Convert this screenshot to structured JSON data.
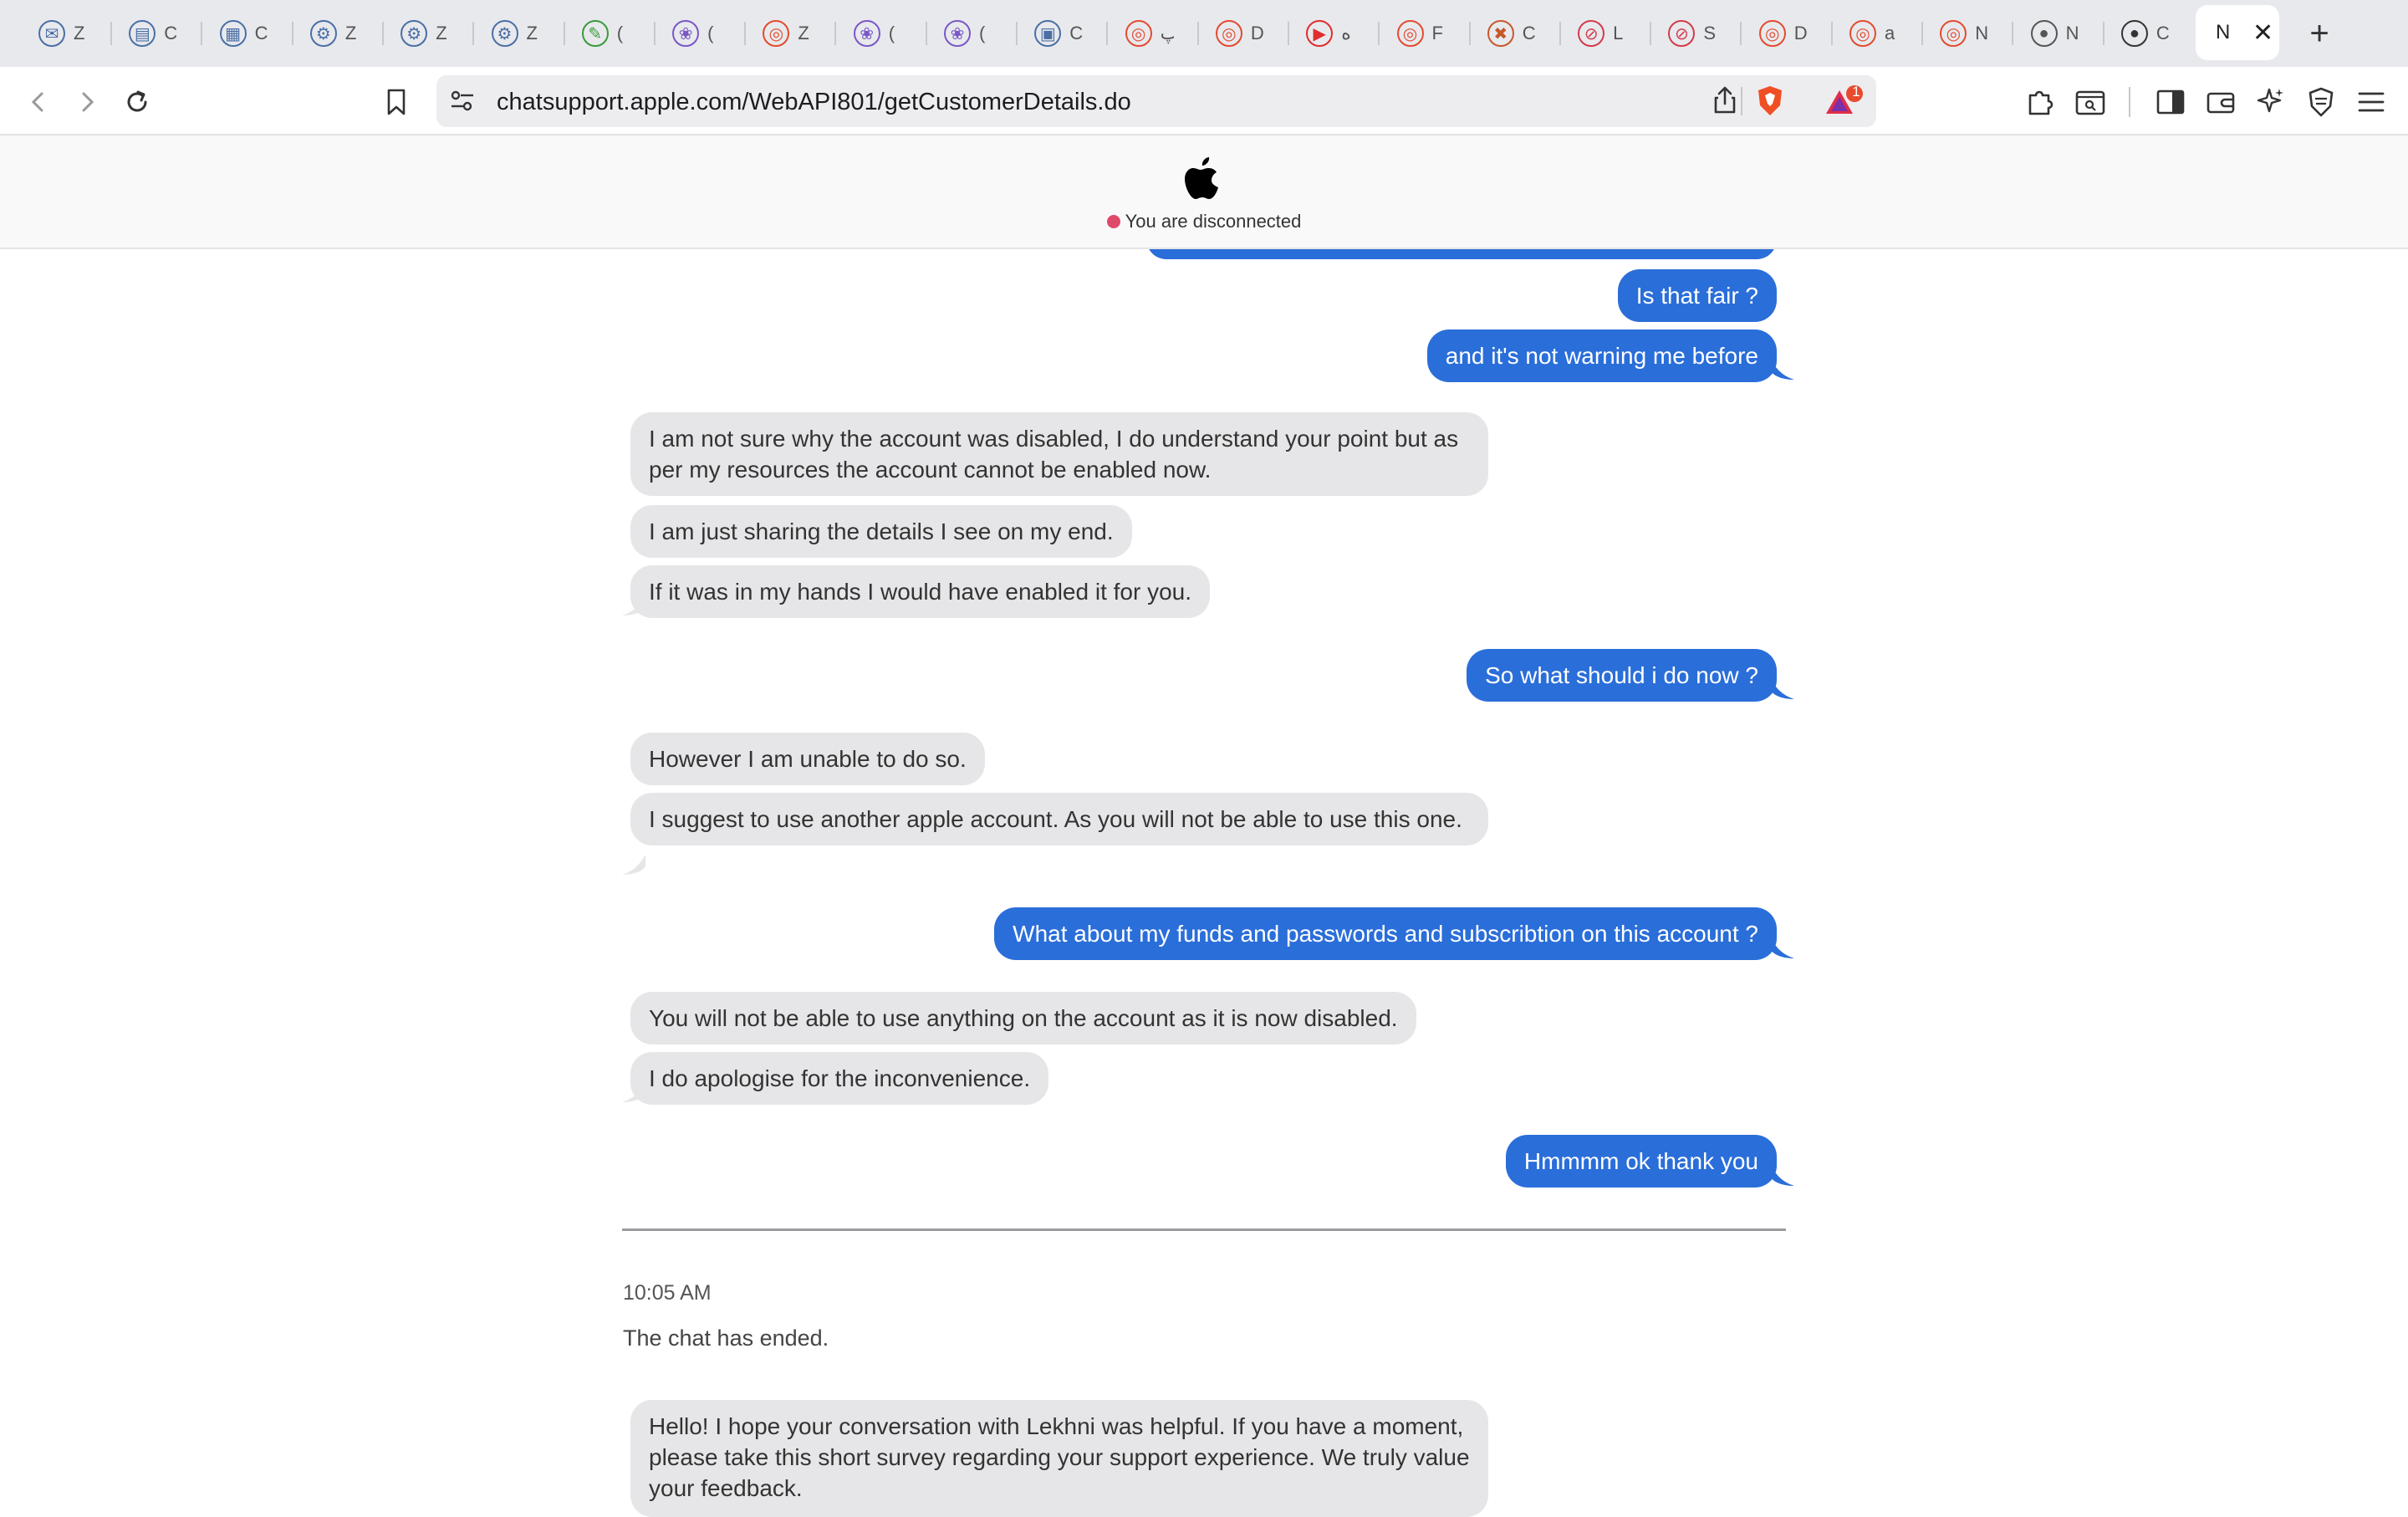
{
  "browser": {
    "tabs": [
      {
        "title": "Z",
        "icon": "mail-icon",
        "color": "#4a6fa5"
      },
      {
        "title": "C",
        "icon": "report-icon",
        "color": "#4a6fa5"
      },
      {
        "title": "C",
        "icon": "doc-icon",
        "color": "#4a6fa5"
      },
      {
        "title": "Z",
        "icon": "gear-icon",
        "color": "#4a6fa5"
      },
      {
        "title": "Z",
        "icon": "gear-icon",
        "color": "#4a6fa5"
      },
      {
        "title": "Z",
        "icon": "gear-icon",
        "color": "#4a6fa5"
      },
      {
        "title": "(",
        "icon": "feather-icon",
        "color": "#3a9a3a"
      },
      {
        "title": "(",
        "icon": "cluster-icon",
        "color": "#7a57c7"
      },
      {
        "title": "Z",
        "icon": "ring-icon",
        "color": "#e34b2e"
      },
      {
        "title": "(",
        "icon": "cluster-icon",
        "color": "#7a57c7"
      },
      {
        "title": "(",
        "icon": "cluster-icon",
        "color": "#7a57c7"
      },
      {
        "title": "C",
        "icon": "window-icon",
        "color": "#4a6fa5"
      },
      {
        "title": "پ",
        "icon": "ring-icon",
        "color": "#e34b2e"
      },
      {
        "title": "D",
        "icon": "ring-icon",
        "color": "#e34b2e"
      },
      {
        "title": "ه",
        "icon": "youtube-icon",
        "color": "#e02d2d"
      },
      {
        "title": "F",
        "icon": "ring-icon",
        "color": "#e34b2e"
      },
      {
        "title": "C",
        "icon": "crossed-icon",
        "color": "#c7582a"
      },
      {
        "title": "L",
        "icon": "slash-icon",
        "color": "#d33b4a"
      },
      {
        "title": "S",
        "icon": "slash-icon",
        "color": "#d33b4a"
      },
      {
        "title": "D",
        "icon": "ring-icon",
        "color": "#e34b2e"
      },
      {
        "title": "a",
        "icon": "ring-icon",
        "color": "#e34b2e"
      },
      {
        "title": "N",
        "icon": "ring-icon",
        "color": "#e34b2e"
      },
      {
        "title": "N",
        "icon": "globe-icon",
        "color": "#555555"
      },
      {
        "title": "C",
        "icon": "apple-icon",
        "color": "#333333"
      }
    ],
    "active_tab": {
      "title": "N"
    },
    "url": "chatsupport.apple.com/WebAPI801/getCustomerDetails.do",
    "notification_count": "1"
  },
  "header": {
    "status": "You are disconnected"
  },
  "chat": {
    "messages": [
      {
        "from": "user",
        "text": "Is that fair ?"
      },
      {
        "from": "user",
        "text": "and it's not warning me before"
      },
      {
        "from": "agent",
        "text": "I am not sure why the account was disabled, I do understand your point but as per my resources the account cannot be enabled now."
      },
      {
        "from": "agent",
        "text": "I am just sharing the details I see on my end."
      },
      {
        "from": "agent",
        "text": "If it was in my hands I would have enabled it for you."
      },
      {
        "from": "user",
        "text": "So what should i do now ?"
      },
      {
        "from": "agent",
        "text": "However I am unable to do so."
      },
      {
        "from": "agent",
        "text": "I suggest to use another apple account. As you will not be able to use this one."
      },
      {
        "from": "user",
        "text": "What about my funds and passwords and subscribtion on this account ?"
      },
      {
        "from": "agent",
        "text": "You will not be able to use anything on the account as it is now disabled."
      },
      {
        "from": "agent",
        "text": "I do apologise for the inconvenience."
      },
      {
        "from": "user",
        "text": "Hmmmm ok thank you"
      }
    ],
    "end_time": "10:05 AM",
    "end_text": "The chat has ended.",
    "survey": "Hello! I hope your conversation with Lekhni was helpful. If you have a moment, please take this short survey regarding your support experience. We truly value your feedback."
  },
  "colors": {
    "user_bubble": "#2a6ed9",
    "agent_bubble": "#e6e6e8",
    "status_dot": "#e04a6a"
  }
}
